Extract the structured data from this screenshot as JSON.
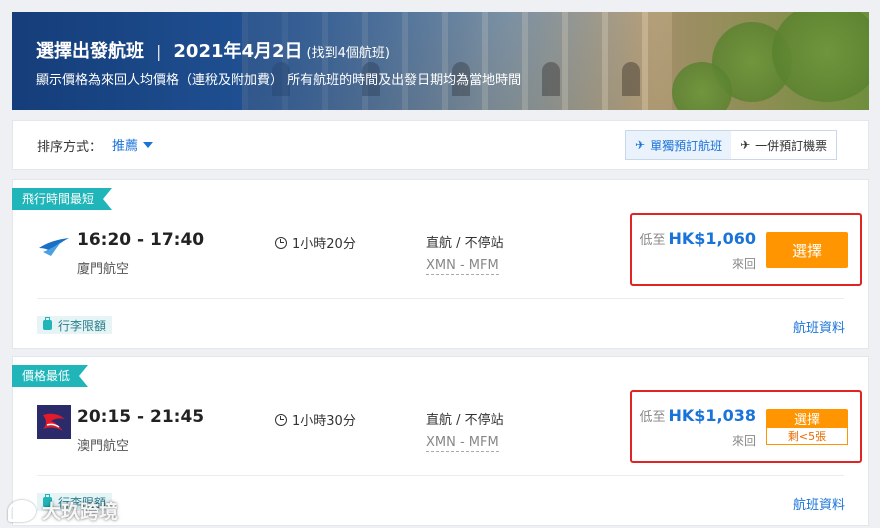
{
  "banner": {
    "title": "選擇出發航班",
    "separator": "|",
    "date": "2021年4月2日",
    "count": "(找到4個航班)",
    "subtitle": "顯示價格為來回人均價格（連稅及附加費） 所有航班的時間及出發日期均為當地時間"
  },
  "sort": {
    "label": "排序方式：",
    "value": "推薦"
  },
  "booking_mode": {
    "single": "單獨預訂航班",
    "bundle": "一併預訂機票",
    "active": "single"
  },
  "flights": [
    {
      "tag": "飛行時間最短",
      "times": "16:20 - 17:40",
      "airline": "廈門航空",
      "airline_logo": "xiamen-airlines-logo",
      "duration": "1小時20分",
      "stops": "直航 / 不停站",
      "route": "XMN - MFM",
      "price_prefix": "低至",
      "price": "HK$1,060",
      "price_sub": "來回",
      "select_label": "選擇",
      "seats_left": "",
      "luggage": "行李限額",
      "info_link": "航班資料"
    },
    {
      "tag": "價格最低",
      "times": "20:15 - 21:45",
      "airline": "澳門航空",
      "airline_logo": "air-macau-logo",
      "duration": "1小時30分",
      "stops": "直航 / 不停站",
      "route": "XMN - MFM",
      "price_prefix": "低至",
      "price": "HK$1,038",
      "price_sub": "來回",
      "select_label": "選擇",
      "seats_left": "剩<5張",
      "luggage": "行李限額",
      "info_link": "航班資料"
    }
  ],
  "watermark": "大玖跨境",
  "colors": {
    "accent": "#1a73d9",
    "select": "#ff9500",
    "tag": "#1fb5b9",
    "highlight_box": "#e02424"
  }
}
